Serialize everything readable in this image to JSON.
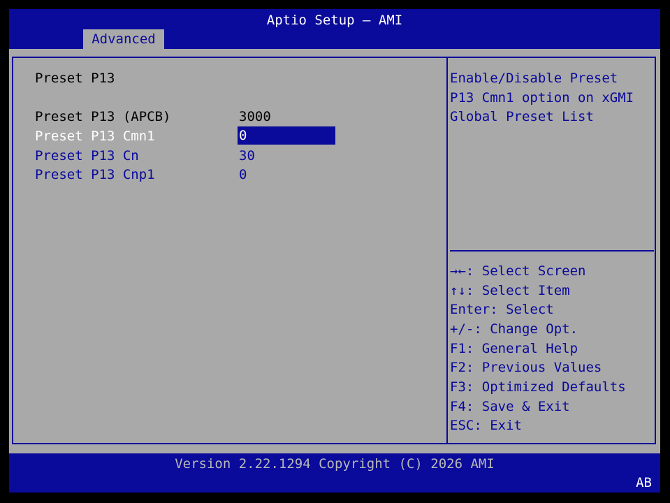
{
  "header": {
    "title": "Aptio Setup – AMI",
    "active_tab": "Advanced"
  },
  "page": {
    "heading": "Preset P13",
    "rows": [
      {
        "label": "Preset P13 (APCB)",
        "value": "3000"
      },
      {
        "label": "Preset P13 Cmn1",
        "value": "0"
      },
      {
        "label": "Preset P13 Cn",
        "value": "30"
      },
      {
        "label": "Preset P13 Cnp1",
        "value": "0"
      }
    ]
  },
  "help": {
    "lines": [
      "Enable/Disable Preset",
      "P13 Cmn1 option on xGMI",
      "Global Preset List"
    ]
  },
  "keys": [
    "→←: Select Screen",
    "↑↓: Select Item",
    "Enter: Select",
    "+/-: Change Opt.",
    "F1: General Help",
    "F2: Previous Values",
    "F3: Optimized Defaults",
    "F4: Save & Exit",
    "ESC: Exit"
  ],
  "footer": {
    "version": "Version 2.22.1294 Copyright (C) 2026 AMI",
    "badge": "AB"
  },
  "colors": {
    "background": "#a9a9a9",
    "frame_blue": "#0a0a9b",
    "highlight_text": "#ffffff"
  }
}
